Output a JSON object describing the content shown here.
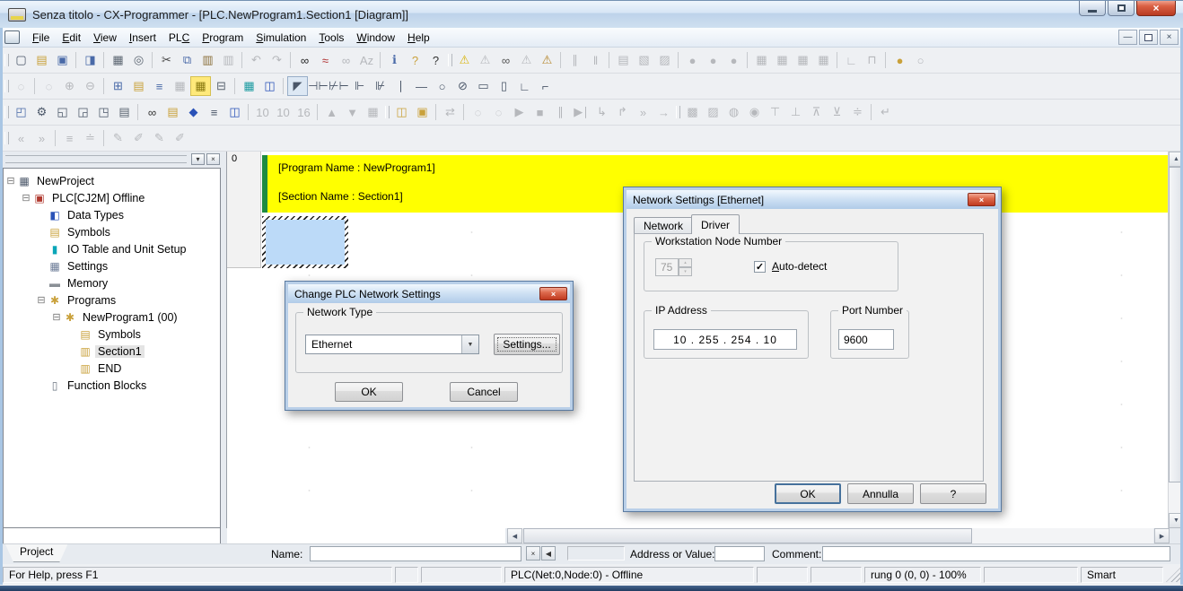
{
  "window": {
    "title": "Senza titolo - CX-Programmer - [PLC.NewProgram1.Section1 [Diagram]]"
  },
  "glyphs": {
    "close": "×",
    "left": "◀",
    "right": "▶",
    "up": "▲",
    "down": "▼",
    "drop": "▾",
    "spin_up": "▴",
    "spin_down": "▾",
    "check": "✓",
    "combo_drop": "▼"
  },
  "menu": {
    "items": [
      {
        "name": "menu-file",
        "pre": "",
        "u": "F",
        "post": "ile"
      },
      {
        "name": "menu-edit",
        "pre": "",
        "u": "E",
        "post": "dit"
      },
      {
        "name": "menu-view",
        "pre": "",
        "u": "V",
        "post": "iew"
      },
      {
        "name": "menu-insert",
        "pre": "",
        "u": "I",
        "post": "nsert"
      },
      {
        "name": "menu-plc",
        "pre": "PL",
        "u": "C",
        "post": ""
      },
      {
        "name": "menu-program",
        "pre": "",
        "u": "P",
        "post": "rogram"
      },
      {
        "name": "menu-simulation",
        "pre": "",
        "u": "S",
        "post": "imulation"
      },
      {
        "name": "menu-tools",
        "pre": "",
        "u": "T",
        "post": "ools"
      },
      {
        "name": "menu-window",
        "pre": "",
        "u": "W",
        "post": "indow"
      },
      {
        "name": "menu-help",
        "pre": "",
        "u": "H",
        "post": "elp"
      }
    ]
  },
  "toolbars": {
    "row1": [
      {
        "grip": 1
      },
      {
        "name": "new-icon",
        "g": "▢",
        "c": "#4a5668"
      },
      {
        "name": "open-icon",
        "g": "▤",
        "c": "#c9a13b"
      },
      {
        "name": "save-icon",
        "g": "▣",
        "c": "#4a6aa8"
      },
      {
        "sep": 1
      },
      {
        "name": "document-search-icon",
        "g": "◨",
        "c": "#4a6aa8"
      },
      {
        "sep": 1
      },
      {
        "name": "print-icon",
        "g": "▦",
        "c": "#5a6470"
      },
      {
        "name": "print-preview-icon",
        "g": "◎",
        "c": "#5a6470"
      },
      {
        "sep": 1
      },
      {
        "name": "cut-icon",
        "g": "✂",
        "c": "#444444"
      },
      {
        "name": "copy-icon",
        "g": "⧉",
        "c": "#4a6aa8"
      },
      {
        "name": "paste-icon",
        "g": "▥",
        "c": "#8a6f3a"
      },
      {
        "name": "paste-rung-icon",
        "g": "▥",
        "disabled": 1
      },
      {
        "sep": 1
      },
      {
        "name": "undo-icon",
        "g": "↶",
        "disabled": 1
      },
      {
        "name": "redo-icon",
        "g": "↷",
        "disabled": 1
      },
      {
        "sep": 1
      },
      {
        "name": "find-icon",
        "g": "∞",
        "c": "#222222"
      },
      {
        "name": "replace-icon",
        "g": "≈",
        "c": "#b03030"
      },
      {
        "name": "find-symbol-icon",
        "g": "∞",
        "disabled": 1
      },
      {
        "name": "find-text-icon",
        "g": "Az",
        "disabled": 1
      },
      {
        "sep": 1
      },
      {
        "name": "info-icon",
        "g": "ℹ",
        "c": "#4a6aa8"
      },
      {
        "name": "help-icon",
        "g": "?",
        "c": "#c9a13b"
      },
      {
        "name": "context-help-icon",
        "g": "?",
        "c": "#333333"
      },
      {
        "grip": 1
      },
      {
        "name": "compile-icon",
        "g": "⚠",
        "c": "#d9b50a"
      },
      {
        "name": "compile-all-icon",
        "g": "⚠",
        "disabled": 1
      },
      {
        "name": "find-warning-icon",
        "g": "∞",
        "c": "#555555"
      },
      {
        "name": "program-check-icon",
        "g": "⚠",
        "disabled": 1
      },
      {
        "name": "transfer-check-icon",
        "g": "⚠",
        "c": "#b5862a"
      },
      {
        "sep": 1
      },
      {
        "name": "online-edit-icon",
        "g": "∥",
        "disabled": 1
      },
      {
        "name": "pause-monitor-icon",
        "g": "‖",
        "disabled": 1
      },
      {
        "sep": 1
      },
      {
        "name": "transfer-program-icon",
        "g": "▤",
        "disabled": 1
      },
      {
        "name": "transfer-settings-icon",
        "g": "▧",
        "disabled": 1
      },
      {
        "name": "transfer-symbols-icon",
        "g": "▨",
        "disabled": 1
      },
      {
        "sep": 1
      },
      {
        "name": "access-level-1-icon",
        "g": "●",
        "disabled": 1
      },
      {
        "name": "access-level-2-icon",
        "g": "●",
        "disabled": 1
      },
      {
        "name": "access-level-3-icon",
        "g": "●",
        "disabled": 1
      },
      {
        "sep": 1
      },
      {
        "name": "memory-view-1-icon",
        "g": "▦",
        "disabled": 1
      },
      {
        "name": "memory-view-2-icon",
        "g": "▦",
        "disabled": 1
      },
      {
        "name": "memory-view-3-icon",
        "g": "▦",
        "disabled": 1
      },
      {
        "name": "memory-view-4-icon",
        "g": "▦",
        "disabled": 1
      },
      {
        "sep": 1
      },
      {
        "name": "step-run-icon",
        "g": "∟",
        "disabled": 1
      },
      {
        "name": "time-chart-icon",
        "g": "⊓",
        "disabled": 1
      },
      {
        "sep": 1
      },
      {
        "name": "protect-icon",
        "g": "●",
        "c": "#c9a13b"
      },
      {
        "name": "release-protect-icon",
        "g": "○",
        "disabled": 1
      }
    ],
    "row2": [
      {
        "grip": 1
      },
      {
        "name": "zoom-tool-icon",
        "g": "◌",
        "disabled": 1
      },
      {
        "sep": 1
      },
      {
        "name": "zoom-region-icon",
        "g": "◌",
        "disabled": 1
      },
      {
        "name": "zoom-in-icon",
        "g": "⊕",
        "disabled": 1
      },
      {
        "name": "zoom-out-icon",
        "g": "⊖",
        "disabled": 1
      },
      {
        "sep": 1
      },
      {
        "name": "show-grid-icon",
        "g": "⊞",
        "c": "#4a6aa8"
      },
      {
        "name": "rung-comment-icon",
        "g": "▤",
        "c": "#c9a13b"
      },
      {
        "name": "rung-list-icon",
        "g": "≡",
        "c": "#4a6aa8"
      },
      {
        "name": "io-monitor-icon",
        "g": "▦",
        "disabled": 1
      },
      {
        "name": "rung-shortcut-icon",
        "g": "▦",
        "c": "#8a7a10",
        "hl": 1
      },
      {
        "name": "block-view-icon",
        "g": "⊟",
        "c": "#5a6470"
      },
      {
        "sep": 1
      },
      {
        "name": "clock-monitor-icon",
        "g": "▦",
        "c": "#1a9aa0"
      },
      {
        "name": "clock-instruction-icon",
        "g": "◫",
        "c": "#2a52b8"
      },
      {
        "sep": 1
      },
      {
        "name": "select-tool-icon",
        "g": "◤",
        "c": "#4a5668",
        "pressed": 1
      },
      {
        "name": "contact-no-icon",
        "g": "⊣⊢",
        "c": "#4a5668"
      },
      {
        "name": "contact-nc-icon",
        "g": "⊬⊢",
        "c": "#4a5668"
      },
      {
        "name": "or-contact-no-icon",
        "g": "⊩",
        "c": "#4a5668"
      },
      {
        "name": "or-contact-nc-icon",
        "g": "⊮",
        "c": "#4a5668"
      },
      {
        "name": "vertical-line-icon",
        "g": "∣",
        "c": "#4a5668"
      },
      {
        "name": "horizontal-line-icon",
        "g": "—",
        "c": "#4a5668"
      },
      {
        "name": "coil-icon",
        "g": "○",
        "c": "#4a5668"
      },
      {
        "name": "coil-nc-icon",
        "g": "⊘",
        "c": "#4a5668"
      },
      {
        "name": "instruction-icon",
        "g": "▭",
        "c": "#4a5668"
      },
      {
        "name": "inverted-instruction-icon",
        "g": "▯",
        "c": "#4a5668"
      },
      {
        "name": "line-branch-icon",
        "g": "∟",
        "c": "#4a5668"
      },
      {
        "name": "delete-line-icon",
        "g": "⌐",
        "c": "#4a5668"
      }
    ],
    "row3": [
      {
        "grip": 1
      },
      {
        "name": "toggle-project-workspace-icon",
        "g": "◰",
        "c": "#4a6aa8"
      },
      {
        "name": "build-icon",
        "g": "⚙",
        "c": "#4a5668"
      },
      {
        "name": "search-results-window-icon",
        "g": "◱",
        "c": "#4a5668"
      },
      {
        "name": "watch-window-icon",
        "g": "◲",
        "c": "#4a5668"
      },
      {
        "name": "cross-reference-icon",
        "g": "◳",
        "c": "#4a5668"
      },
      {
        "name": "properties-icon",
        "g": "▤",
        "c": "#5a6470"
      },
      {
        "sep": 1
      },
      {
        "name": "monitor-find-icon",
        "g": "∞",
        "c": "#333333"
      },
      {
        "name": "io-comment-icon",
        "g": "▤",
        "c": "#c9a13b"
      },
      {
        "name": "shield-icon",
        "g": "◆",
        "c": "#2a52b8"
      },
      {
        "name": "list-view-icon",
        "g": "≡",
        "c": "#4a5668"
      },
      {
        "name": "address-reference-icon",
        "g": "◫",
        "c": "#2a52b8"
      },
      {
        "sep": 1
      },
      {
        "name": "decimal-10-icon",
        "g": "10",
        "disabled": 1
      },
      {
        "name": "signed-decimal-10-icon",
        "g": "10",
        "disabled": 1
      },
      {
        "name": "hex-16-icon",
        "g": "16",
        "disabled": 1
      },
      {
        "sep": 1
      },
      {
        "name": "set-value-up-icon",
        "g": "▲",
        "disabled": 1
      },
      {
        "name": "set-value-down-icon",
        "g": "▼",
        "disabled": 1
      },
      {
        "name": "force-status-icon",
        "g": "▦",
        "disabled": 1
      },
      {
        "grip": 1
      },
      {
        "name": "work-online-icon",
        "g": "◫",
        "c": "#c9a13b"
      },
      {
        "name": "work-online-simulator-icon",
        "g": "▣",
        "c": "#c9a13b"
      },
      {
        "sep": 1
      },
      {
        "name": "transfer-diff-icon",
        "g": "⇄",
        "disabled": 1
      },
      {
        "sep": 1
      },
      {
        "name": "monitor-pause-icon",
        "g": "◌",
        "disabled": 1
      },
      {
        "name": "monitor-pause-trigger-icon",
        "g": "◌",
        "disabled": 1
      },
      {
        "name": "sim-run-icon",
        "g": "▶",
        "disabled": 1
      },
      {
        "name": "sim-stop-icon",
        "g": "■",
        "disabled": 1
      },
      {
        "name": "sim-pause-icon",
        "g": "∥",
        "disabled": 1
      },
      {
        "name": "sim-step-icon",
        "g": "▶∣",
        "disabled": 1
      },
      {
        "name": "sim-step-in-icon",
        "g": "↳",
        "disabled": 1
      },
      {
        "name": "sim-step-over-icon",
        "g": "↱",
        "disabled": 1
      },
      {
        "name": "sim-continuous-icon",
        "g": "»",
        "disabled": 1
      },
      {
        "name": "sim-run-to-icon",
        "g": "→",
        "disabled": 1
      },
      {
        "grip": 1
      },
      {
        "name": "diff-up-icon",
        "g": "▩",
        "disabled": 1
      },
      {
        "name": "diff-down-icon",
        "g": "▨",
        "disabled": 1
      },
      {
        "name": "force-set-icon",
        "g": "◍",
        "disabled": 1
      },
      {
        "name": "force-reset-icon",
        "g": "◉",
        "disabled": 1
      },
      {
        "name": "force-cancel-icon",
        "g": "⊤",
        "disabled": 1
      },
      {
        "name": "set-bit-icon",
        "g": "⊥",
        "disabled": 1
      },
      {
        "name": "reset-bit-icon",
        "g": "⊼",
        "disabled": 1
      },
      {
        "name": "toggle-bit-icon",
        "g": "⊻",
        "disabled": 1
      },
      {
        "name": "update-online-icon",
        "g": "≑",
        "disabled": 1
      },
      {
        "sep": 1
      },
      {
        "name": "insert-row-icon",
        "g": "↵",
        "disabled": 1
      }
    ],
    "row4": [
      {
        "grip": 1
      },
      {
        "name": "previous-rung-icon",
        "g": "«",
        "disabled": 1
      },
      {
        "name": "next-rung-icon",
        "g": "»",
        "disabled": 1
      },
      {
        "sep": 1
      },
      {
        "name": "rung-comment-list-icon",
        "g": "≡",
        "disabled": 1
      },
      {
        "name": "rung-wrap-icon",
        "g": "≐",
        "disabled": 1
      },
      {
        "sep": 1
      },
      {
        "name": "insert-mode-icon",
        "g": "✎",
        "disabled": 1
      },
      {
        "name": "overwrite-mode-icon",
        "g": "✐",
        "disabled": 1
      },
      {
        "name": "edit-comment-icon",
        "g": "✎",
        "disabled": 1
      },
      {
        "name": "edit-rung-icon",
        "g": "✐",
        "disabled": 1
      }
    ]
  },
  "tree": {
    "tab": "Project",
    "items": [
      {
        "name": "tree-item-newproject",
        "level": 0,
        "exp": "⊟",
        "g": "▦",
        "c": "#4a5668",
        "label": "NewProject"
      },
      {
        "name": "tree-item-plc",
        "level": 1,
        "exp": "⊟",
        "g": "▣",
        "c": "#b03a30",
        "label": "PLC[CJ2M] Offline"
      },
      {
        "name": "tree-item-data-types",
        "level": 2,
        "g": "◧",
        "c": "#2a52b8",
        "label": "Data Types"
      },
      {
        "name": "tree-item-symbols",
        "level": 2,
        "g": "▤",
        "c": "#c9a13b",
        "label": "Symbols"
      },
      {
        "name": "tree-item-io-table",
        "level": 2,
        "g": "▮",
        "c": "#0aa6b8",
        "label": "IO Table and Unit Setup"
      },
      {
        "name": "tree-item-settings",
        "level": 2,
        "g": "▦",
        "c": "#6a7a96",
        "label": "Settings"
      },
      {
        "name": "tree-item-memory",
        "level": 2,
        "g": "▬",
        "c": "#8a9096",
        "label": "Memory"
      },
      {
        "name": "tree-item-programs",
        "level": 2,
        "exp": "⊟",
        "g": "✱",
        "c": "#c9a13b",
        "label": "Programs"
      },
      {
        "name": "tree-item-newprogram1",
        "level": 3,
        "exp": "⊟",
        "g": "✱",
        "c": "#c9a13b",
        "label": "NewProgram1 (00)"
      },
      {
        "name": "tree-item-program-symbols",
        "level": 4,
        "g": "▤",
        "c": "#c9a13b",
        "label": "Symbols"
      },
      {
        "name": "tree-item-section1",
        "level": 4,
        "g": "▥",
        "c": "#c9a13b",
        "label": "Section1",
        "selected": 1
      },
      {
        "name": "tree-item-end",
        "level": 4,
        "g": "▥",
        "c": "#c9a13b",
        "label": "END"
      },
      {
        "name": "tree-item-function-blocks",
        "level": 2,
        "g": "▯",
        "c": "#6a7480",
        "label": "Function Blocks"
      }
    ]
  },
  "diagram": {
    "rung_number": "0",
    "program_line": "[Program Name : NewProgram1]",
    "section_line": "[Section Name : Section1]"
  },
  "watch": {
    "name_label": "Name:",
    "address_label": "Address or Value:",
    "comment_label": "Comment:"
  },
  "status": {
    "help": "For Help, press F1",
    "plc": "PLC(Net:0,Node:0) - Offline",
    "rung": "rung 0 (0, 0)  - 100%",
    "mode": "Smart"
  },
  "dialog_change": {
    "title": "Change PLC Network Settings",
    "group_label": "Network Type",
    "combo_value": "Ethernet",
    "settings_button": "Settings...",
    "ok": "OK",
    "cancel": "Cancel"
  },
  "dialog_network": {
    "title": "Network Settings [Ethernet]",
    "tab_network": "Network",
    "tab_driver": "Driver",
    "group_node": "Workstation Node Number",
    "node_value": "75",
    "autodetect_u": "A",
    "autodetect_rest": "uto-detect",
    "autodetect_checked": true,
    "group_ip": "IP Address",
    "ip_value": "10  .  255  .  254  .  10",
    "group_port": "Port Number",
    "port_value": "9600",
    "ok": "OK",
    "cancel": "Annulla",
    "help": "?"
  },
  "colors": {
    "highlight_yellow": "#ffff00",
    "rung_green": "#1f8b40",
    "selection_blue": "#bcdaf8",
    "titlebar_blue": "#cfe0f0",
    "close_red": "#c03a20"
  }
}
